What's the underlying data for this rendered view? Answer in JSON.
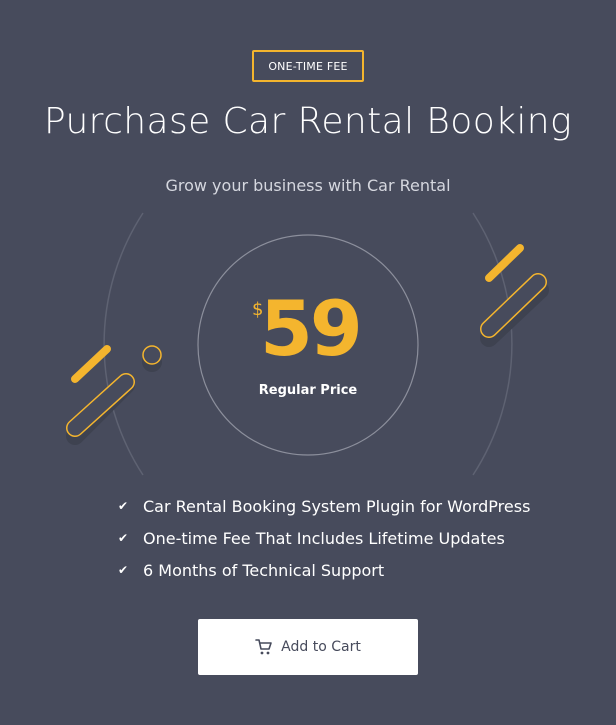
{
  "badge": {
    "label": "ONE-TIME FEE"
  },
  "header": {
    "title": "Purchase Car Rental Booking",
    "subtitle": "Grow your business with Car Rental"
  },
  "price": {
    "currency": "$",
    "amount": "59",
    "label": "Regular Price"
  },
  "features": [
    {
      "icon": "check-icon",
      "text": "Car Rental Booking System Plugin for WordPress"
    },
    {
      "icon": "check-icon",
      "text": "One-time Fee That Includes Lifetime Updates"
    },
    {
      "icon": "check-icon",
      "text": "6 Months of Technical Support"
    }
  ],
  "cta": {
    "icon": "cart-icon",
    "label": "Add to Cart"
  },
  "colors": {
    "background": "#474b5c",
    "accent": "#f4b52e",
    "text": "#ffffff",
    "button_bg": "#ffffff",
    "button_text": "#474b5c"
  }
}
